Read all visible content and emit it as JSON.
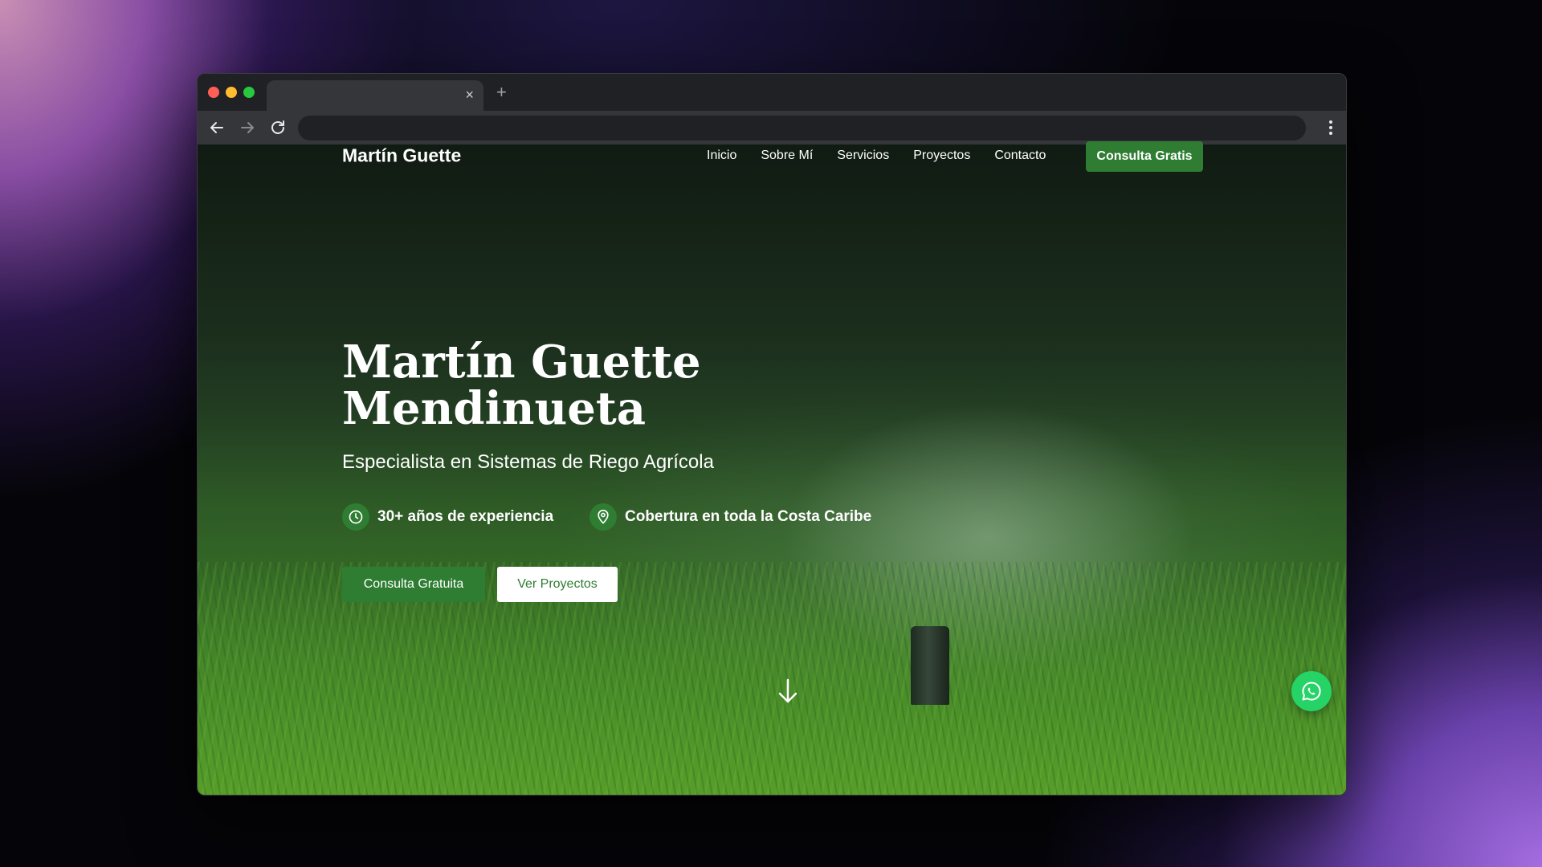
{
  "browser": {
    "tab_close_glyph": "×",
    "new_tab_glyph": "+",
    "icons": [
      "back-arrow-icon",
      "forward-arrow-icon",
      "reload-icon",
      "kebab-menu-icon"
    ]
  },
  "site": {
    "brand": "Martín Guette",
    "nav": [
      "Inicio",
      "Sobre Mí",
      "Servicios",
      "Proyectos",
      "Contacto"
    ],
    "nav_cta": "Consulta Gratis"
  },
  "hero": {
    "title_line1": "Martín Guette",
    "title_line2": "Mendinueta",
    "subtitle": "Especialista en Sistemas de Riego Agrícola",
    "features": [
      {
        "icon": "clock-icon",
        "text": "30+ años de experiencia"
      },
      {
        "icon": "location-pin-icon",
        "text": "Cobertura en toda la Costa Caribe"
      }
    ],
    "primary_button": "Consulta Gratuita",
    "secondary_button": "Ver Proyectos"
  },
  "colors": {
    "accent_green": "#2e7d32",
    "whatsapp_green": "#25d366",
    "browser_chrome": "#202124",
    "toolbar": "#35363a"
  }
}
